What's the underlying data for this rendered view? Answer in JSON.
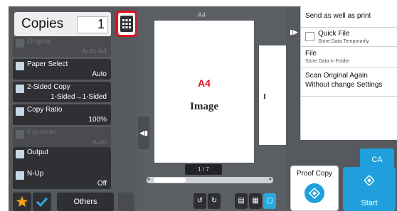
{
  "copies": {
    "label": "Copies",
    "count": "1"
  },
  "functions": [
    {
      "name": "Original",
      "value": "Auto   A4",
      "enabled": false
    },
    {
      "name": "Paper Select",
      "value": "Auto",
      "enabled": true
    },
    {
      "name": "2-Sided Copy",
      "value": "1-Sided→1-Sided",
      "enabled": true
    },
    {
      "name": "Copy Ratio",
      "value": "100%",
      "enabled": true
    },
    {
      "name": "Exposure",
      "value": "Auto",
      "enabled": false
    },
    {
      "name": "Output",
      "value": "",
      "enabled": true
    },
    {
      "name": "N-Up",
      "value": "Off",
      "enabled": true
    }
  ],
  "bottom_bar": {
    "others_label": "Others",
    "star_icon": "star-icon",
    "check_icon": "check-icon"
  },
  "preview": {
    "page_size_label": "A4",
    "page_size_red": "A4",
    "page_content": "Image",
    "second_page_text": "I",
    "page_indicator": "1 / 7"
  },
  "action_menu": {
    "items": [
      {
        "main": "Send as well as print",
        "sub": ""
      },
      {
        "main": "Quick File",
        "sub": "Store Data Temporarily",
        "checkbox": true
      },
      {
        "main": "File",
        "sub": "Store Data in Folder"
      },
      {
        "main": "Scan Original Again\nWithout change Settings",
        "sub": ""
      }
    ]
  },
  "buttons": {
    "ca": "CA",
    "proof_copy": "Proof Copy",
    "start": "Start"
  },
  "colors": {
    "accent": "#1fa0dc",
    "highlight": "#e0101e",
    "panel": "#56595d",
    "button": "#2e3033"
  }
}
